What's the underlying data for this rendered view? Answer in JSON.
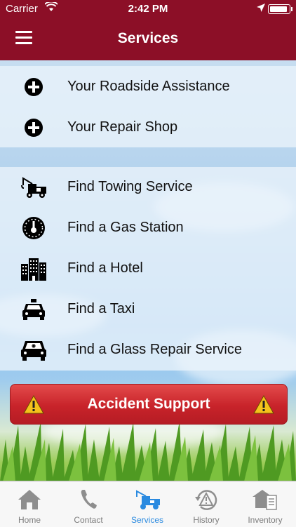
{
  "status_bar": {
    "carrier": "Carrier",
    "time": "2:42 PM"
  },
  "header": {
    "title": "Services",
    "menu_icon": "hamburger-menu-icon"
  },
  "my_services": [
    {
      "label": "Your Roadside Assistance",
      "icon": "plus-circle-icon"
    },
    {
      "label": "Your Repair Shop",
      "icon": "plus-circle-icon"
    }
  ],
  "find_services": [
    {
      "label": "Find Towing Service",
      "icon": "tow-truck-icon"
    },
    {
      "label": "Find a Gas Station",
      "icon": "fuel-gauge-icon"
    },
    {
      "label": "Find a Hotel",
      "icon": "hotel-icon"
    },
    {
      "label": "Find a Taxi",
      "icon": "taxi-icon"
    },
    {
      "label": "Find a Glass Repair Service",
      "icon": "glass-repair-car-icon"
    }
  ],
  "accident_button": {
    "label": "Accident Support",
    "icon": "warning-icon"
  },
  "tabs": [
    {
      "label": "Home",
      "icon": "home-icon",
      "active": false
    },
    {
      "label": "Contact",
      "icon": "phone-icon",
      "active": false
    },
    {
      "label": "Services",
      "icon": "tow-truck-icon",
      "active": true
    },
    {
      "label": "History",
      "icon": "history-warning-icon",
      "active": false
    },
    {
      "label": "Inventory",
      "icon": "inventory-icon",
      "active": false
    }
  ],
  "colors": {
    "brand": "#8c0f27",
    "accent": "#2a8ae0",
    "alert": "#c8232a"
  }
}
